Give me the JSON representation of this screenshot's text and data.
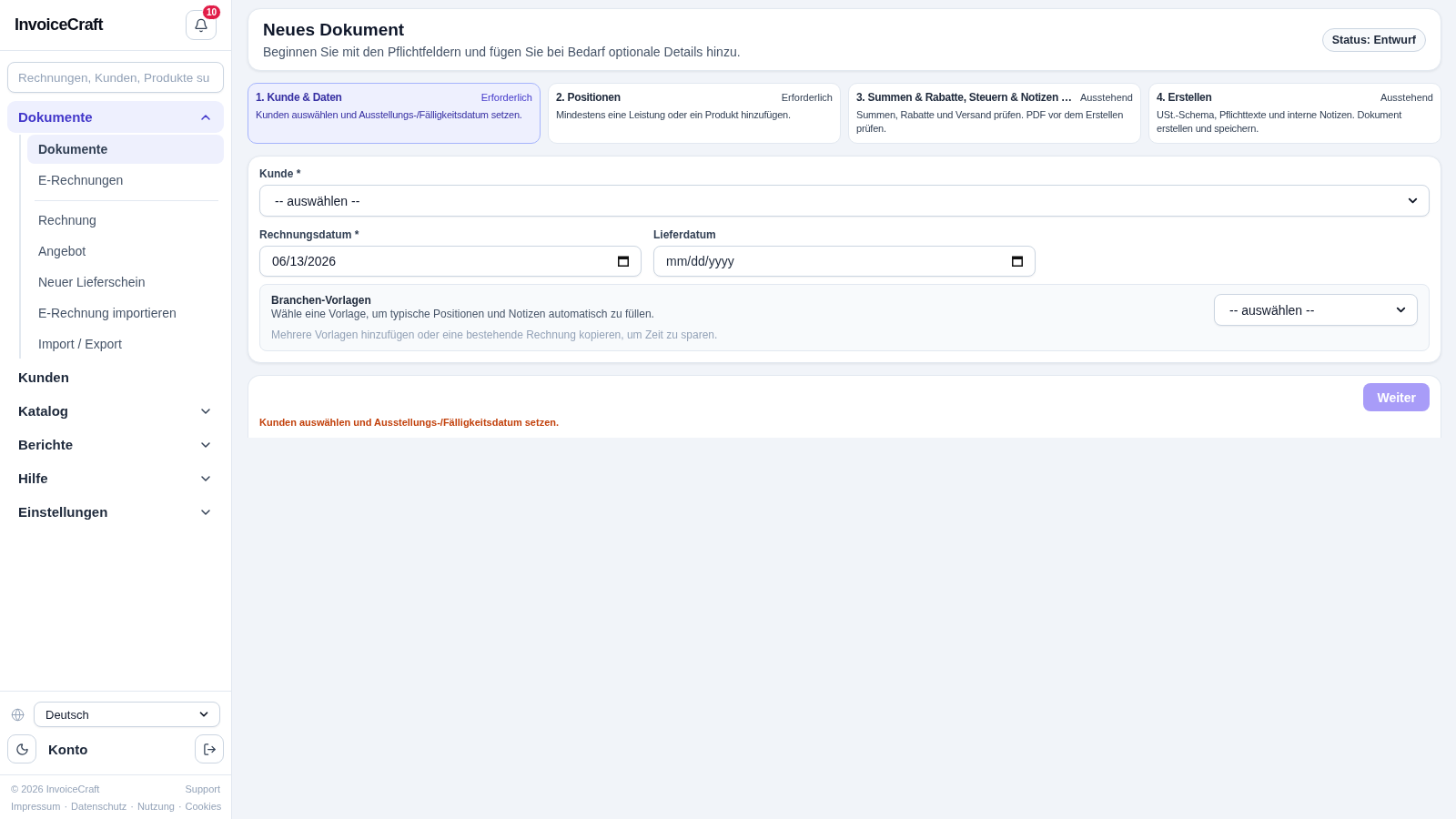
{
  "sidebar": {
    "logo": "InvoiceCraft",
    "notifications": {
      "count": "10"
    },
    "search": {
      "placeholder": "Rechnungen, Kunden, Produkte su"
    },
    "nav": [
      {
        "label": "Dokumente",
        "kind": "group",
        "expanded": true,
        "selected": true,
        "children": [
          {
            "label": "Dokumente",
            "selected": true,
            "divider_after": false
          },
          {
            "label": "E-Rechnungen",
            "selected": false,
            "divider_after": true
          },
          {
            "label": "Rechnung",
            "selected": false,
            "divider_after": false
          },
          {
            "label": "Angebot",
            "selected": false,
            "divider_after": false
          },
          {
            "label": "Neuer Lieferschein",
            "selected": false,
            "divider_after": false
          },
          {
            "label": "E-Rechnung importieren",
            "selected": false,
            "divider_after": false
          },
          {
            "label": "Import / Export",
            "selected": false,
            "divider_after": false
          }
        ]
      },
      {
        "label": "Kunden",
        "kind": "link",
        "selected": false
      },
      {
        "label": "Katalog",
        "kind": "group",
        "expanded": false,
        "selected": false
      },
      {
        "label": "Berichte",
        "kind": "group",
        "expanded": false,
        "selected": false
      },
      {
        "label": "Hilfe",
        "kind": "group",
        "expanded": false,
        "selected": false
      },
      {
        "label": "Einstellungen",
        "kind": "group",
        "expanded": false,
        "selected": false
      }
    ],
    "language": {
      "value": "Deutsch"
    },
    "account": {
      "label": "Konto"
    },
    "footer": {
      "copyright": "© 2026 InvoiceCraft",
      "support": "Support",
      "links": [
        "Impressum",
        "Datenschutz",
        "Nutzung",
        "Cookies"
      ],
      "separator": "·"
    }
  },
  "header": {
    "title": "Neues Dokument",
    "subtitle": "Beginnen Sie mit den Pflichtfeldern und fügen Sie bei Bedarf optionale Details hinzu.",
    "status": "Status: Entwurf"
  },
  "steps": [
    {
      "title": "1. Kunde & Daten",
      "state": "Erforderlich",
      "description": "Kunden auswählen und Ausstellungs-/Fälligkeitsdatum setzen.",
      "selected": true
    },
    {
      "title": "2. Positionen",
      "state": "Erforderlich",
      "description": "Mindestens eine Leistung oder ein Produkt hinzufügen.",
      "selected": false
    },
    {
      "title": "3. Summen & Rabatte, Steuern & Notizen …",
      "state": "Ausstehend",
      "description": "Summen, Rabatte und Versand prüfen. PDF vor dem Erstellen prüfen.",
      "selected": false
    },
    {
      "title": "4. Erstellen",
      "state": "Ausstehend",
      "description": "USt.-Schema, Pflichttexte und interne Notizen. Dokument erstellen und speichern.",
      "selected": false
    }
  ],
  "form": {
    "customer": {
      "label": "Kunde *",
      "value": "-- auswählen --"
    },
    "invoice_date": {
      "label": "Rechnungsdatum *",
      "value": "06/13/2026"
    },
    "delivery_date": {
      "label": "Lieferdatum",
      "placeholder": "mm/dd/yyyy"
    },
    "templates": {
      "title": "Branchen-Vorlagen",
      "description": "Wähle eine Vorlage, um typische Positionen und Notizen automatisch zu füllen.",
      "hint": "Mehrere Vorlagen hinzufügen oder eine bestehende Rechnung kopieren, um Zeit zu sparen.",
      "select": {
        "value": "-- auswählen --"
      }
    }
  },
  "footer_bar": {
    "next_button": {
      "label": "Weiter",
      "disabled": true
    },
    "message": "Kunden auswählen und Ausstellungs-/Fälligkeitsdatum setzen."
  }
}
